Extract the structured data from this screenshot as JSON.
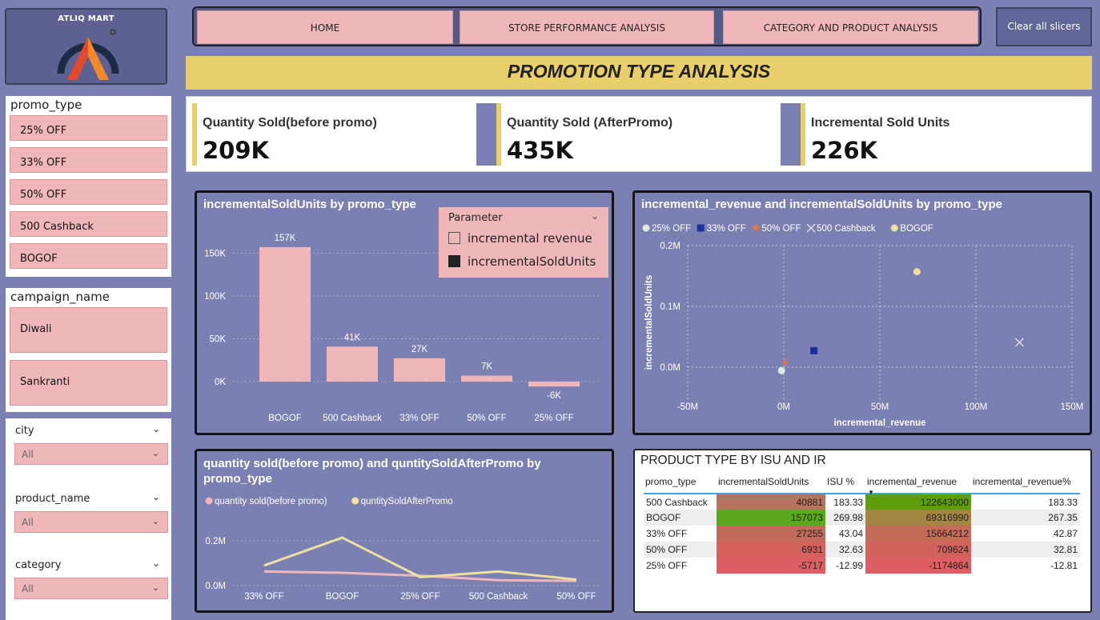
{
  "logo": {
    "brand": "ATLIQ MART"
  },
  "slicers": {
    "promo_type": {
      "title": "promo_type",
      "items": [
        "25% OFF",
        "33% OFF",
        "50% OFF",
        "500 Cashback",
        "BOGOF"
      ]
    },
    "campaign_name": {
      "title": "campaign_name",
      "items": [
        "Diwali",
        "Sankranti"
      ]
    },
    "city": {
      "title": "city",
      "value": "All"
    },
    "product_name": {
      "title": "product_name",
      "value": "All"
    },
    "category": {
      "title": "category",
      "value": "All"
    }
  },
  "nav": {
    "home": "HOME",
    "store": "STORE PERFORMANCE ANALYSIS",
    "category": "CATEGORY AND PRODUCT ANALYSIS",
    "clear": "Clear all slicers"
  },
  "page_title": "PROMOTION TYPE ANALYSIS",
  "kpis": [
    {
      "label": "Quantity Sold(before promo)",
      "value": "209K"
    },
    {
      "label": "Quantity Sold (AfterPromo)",
      "value": "435K"
    },
    {
      "label": "Incremental Sold Units",
      "value": "226K"
    }
  ],
  "colors": {
    "background": "#7b80b2",
    "pink": "#f0b7ba",
    "yellow": "#e8cf6a"
  },
  "parameter": {
    "header": "Parameter",
    "options": [
      "incremental revenue",
      "incrementalSoldUnits"
    ],
    "selected": "incrementalSoldUnits"
  },
  "chart_data": [
    {
      "type": "bar",
      "title": "incrementalSoldUnits by promo_type",
      "categories": [
        "BOGOF",
        "500 Cashback",
        "33% OFF",
        "50% OFF",
        "25% OFF"
      ],
      "values": [
        157073,
        40881,
        27255,
        6931,
        -5717
      ],
      "data_labels": [
        "157K",
        "41K",
        "27K",
        "7K",
        "-6K"
      ],
      "yticks": [
        "0K",
        "50K",
        "100K",
        "150K"
      ],
      "ylim": [
        -10000,
        170000
      ],
      "color": "#f0b7ba"
    },
    {
      "type": "scatter",
      "title": "incremental_revenue and incrementalSoldUnits by promo_type",
      "xlabel": "incremental_revenue",
      "ylabel": "incrementalSoldUnits",
      "xticks": [
        "-50M",
        "0M",
        "50M",
        "100M",
        "150M"
      ],
      "yticks": [
        "0.0M",
        "0.1M",
        "0.2M"
      ],
      "xlim": [
        -50000000,
        150000000
      ],
      "ylim": [
        -20000,
        200000
      ],
      "series": [
        {
          "name": "25% OFF",
          "marker": "circle",
          "color": "#e6e6e6",
          "x": -1174864,
          "y": -5717
        },
        {
          "name": "33% OFF",
          "marker": "square",
          "color": "#1c2f9c",
          "x": 15664212,
          "y": 27255
        },
        {
          "name": "50% OFF",
          "marker": "diamond",
          "color": "#e0744b",
          "x": 709624,
          "y": 6931
        },
        {
          "name": "500 Cashback",
          "marker": "x",
          "color": "#e6e6e6",
          "x": 122643000,
          "y": 40881
        },
        {
          "name": "BOGOF",
          "marker": "circle",
          "color": "#ede1a0",
          "x": 69316990,
          "y": 157073
        }
      ],
      "grid": true,
      "legend": "top-left"
    },
    {
      "type": "line",
      "title": "quantity sold(before promo) and quntitySoldAfterPromo by promo_type",
      "categories": [
        "33% OFF",
        "BOGOF",
        "25% OFF",
        "500 Cashback",
        "50% OFF"
      ],
      "yticks": [
        "0.0M",
        "0.2M"
      ],
      "ylim": [
        0,
        260000
      ],
      "series": [
        {
          "name": "quantity sold(before promo)",
          "color": "#f0b7ba",
          "values": [
            63000,
            57000,
            44000,
            24000,
            21000
          ]
        },
        {
          "name": "quntitySoldAfterPromo",
          "color": "#ede1a0",
          "values": [
            90000,
            214000,
            38000,
            63000,
            27000
          ]
        }
      ],
      "legend": "top-left"
    }
  ],
  "table": {
    "title": "PRODUCT TYPE BY ISU AND IR",
    "columns": [
      "promo_type",
      "incrementalSoldUnits",
      "ISU %",
      "incremental_revenue",
      "incremental_revenue%"
    ],
    "rows": [
      {
        "promo_type": "500 Cashback",
        "isu": "40881",
        "isu_pct": "183.33",
        "ir": "122643000",
        "ir_pct": "183.33",
        "isu_color": "#b87360",
        "ir_color": "#5d9f0a"
      },
      {
        "promo_type": "BOGOF",
        "isu": "157073",
        "isu_pct": "269.98",
        "ir": "69316990",
        "ir_pct": "267.35",
        "isu_color": "#5aa81b",
        "ir_color": "#a58542"
      },
      {
        "promo_type": "33% OFF",
        "isu": "27255",
        "isu_pct": "43.04",
        "ir": "15664212",
        "ir_pct": "42.87",
        "isu_color": "#c16b5a",
        "ir_color": "#c66b58"
      },
      {
        "promo_type": "50% OFF",
        "isu": "6931",
        "isu_pct": "32.63",
        "ir": "709624",
        "ir_pct": "32.81",
        "isu_color": "#d6625d",
        "ir_color": "#d1625c"
      },
      {
        "promo_type": "25% OFF",
        "isu": "-5717",
        "isu_pct": "-12.99",
        "ir": "-1174864",
        "ir_pct": "-12.81",
        "isu_color": "#dd5f64",
        "ir_color": "#dd5f64"
      }
    ]
  }
}
